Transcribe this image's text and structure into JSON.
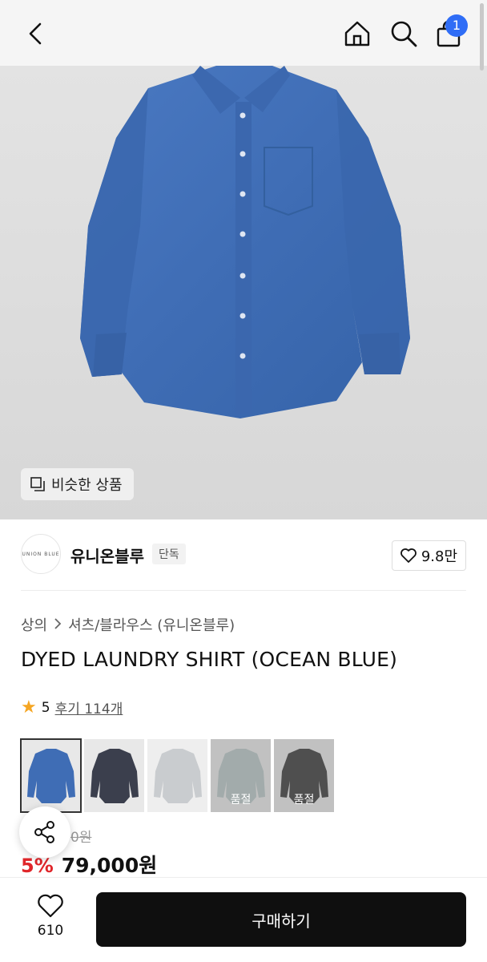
{
  "header": {
    "icons": [
      "back-icon",
      "home-icon",
      "search-icon",
      "shopping-bag-icon"
    ],
    "cart_count": "1"
  },
  "hero": {
    "similar_button_label": "비슷한 상품",
    "background_color": "#dcdcdc",
    "product_color": "#3f6db5"
  },
  "brand": {
    "logo_text": "UNION BLUE",
    "name": "유니온블루",
    "tag": "단독",
    "likes": "9.8만"
  },
  "breadcrumb": {
    "category": "상의",
    "subcategory": "셔츠/블라우스 (유니온블루)"
  },
  "product": {
    "title": "DYED LAUNDRY SHIRT (OCEAN BLUE)",
    "rating": "5",
    "reviews": "후기 114개"
  },
  "swatches": [
    {
      "color": "#3f6db5",
      "sold_out": false,
      "selected": true,
      "label": ""
    },
    {
      "color": "#3b3f4d",
      "sold_out": false,
      "selected": false,
      "label": ""
    },
    {
      "color": "#c9cccf",
      "sold_out": false,
      "selected": false,
      "label": ""
    },
    {
      "color": "#b9c7c7",
      "sold_out": true,
      "selected": false,
      "label": "품절"
    },
    {
      "color": "#3a3a3a",
      "sold_out": true,
      "selected": false,
      "label": "품절"
    }
  ],
  "pricing": {
    "original_price": "0원",
    "discount": "5%",
    "price": "79,000원"
  },
  "bottom_bar": {
    "wish_count": "610",
    "buy_label": "구매하기"
  },
  "colors": {
    "accent_blue": "#2f6df6",
    "discount_red": "#e0262a",
    "buy_button": "#0f0f0f",
    "star": "#f5a623"
  }
}
